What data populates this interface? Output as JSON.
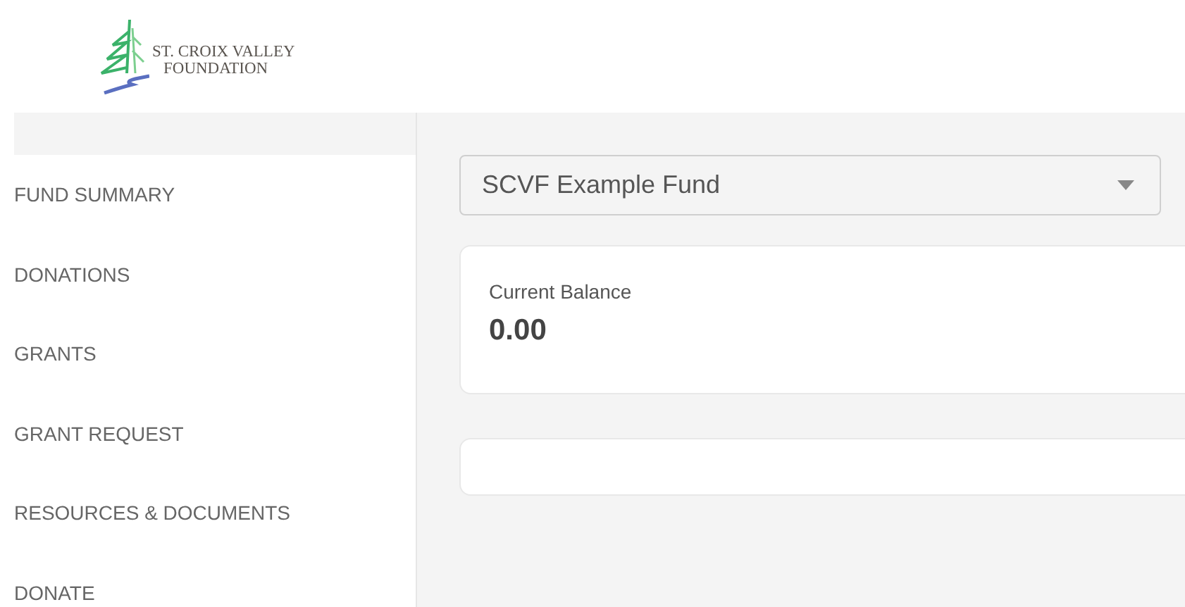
{
  "logo": {
    "lines": [
      "ST. CROIX VALLEY",
      "FOUNDATION"
    ]
  },
  "sidebar": {
    "items": [
      {
        "label": "FUND SUMMARY"
      },
      {
        "label": "DONATIONS"
      },
      {
        "label": "GRANTS"
      },
      {
        "label": "GRANT REQUEST"
      },
      {
        "label": "RESOURCES & DOCUMENTS"
      },
      {
        "label": "DONATE"
      }
    ]
  },
  "fund_select": {
    "value": "SCVF Example Fund"
  },
  "balance_card": {
    "label": "Current Balance",
    "value": "0.00"
  }
}
